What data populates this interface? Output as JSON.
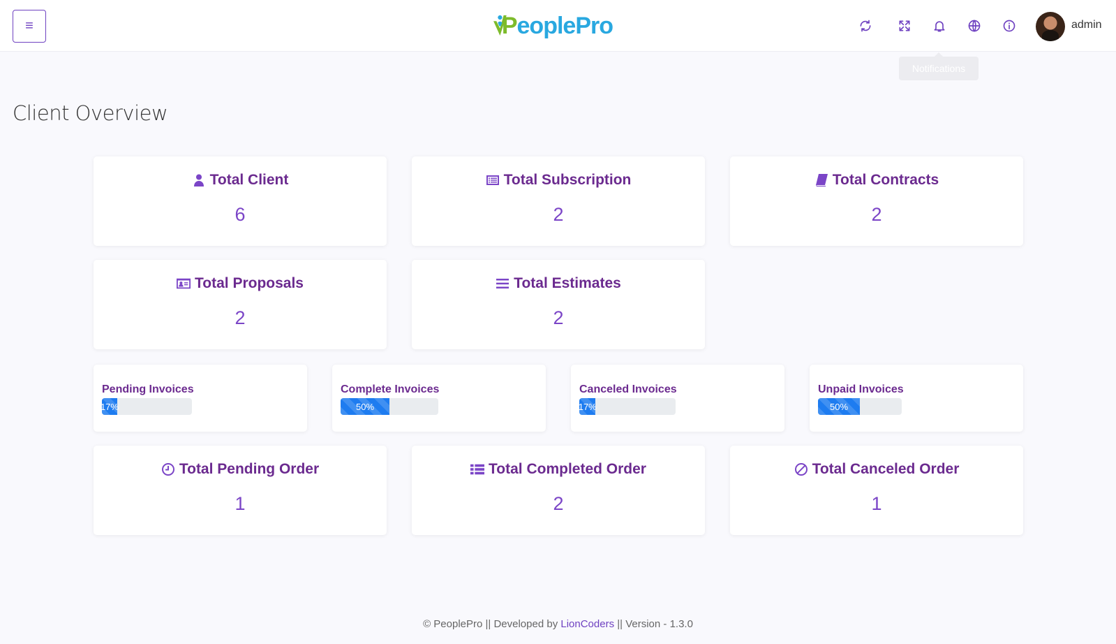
{
  "header": {
    "logo": {
      "part1": "P",
      "part2": "eoplePro"
    },
    "tooltip": "Notifications",
    "user_name": "admin"
  },
  "page": {
    "title": "Client Overview"
  },
  "cards": [
    {
      "title": "Total Client",
      "value": "6",
      "icon": "user-icon"
    },
    {
      "title": "Total Subscription",
      "value": "2",
      "icon": "list-alt-icon"
    },
    {
      "title": "Total Contracts",
      "value": "2",
      "icon": "book-icon"
    },
    {
      "title": "Total Proposals",
      "value": "2",
      "icon": "id-card-icon"
    },
    {
      "title": "Total Estimates",
      "value": "2",
      "icon": "bars-icon"
    }
  ],
  "invoices": [
    {
      "label": "Pending Invoices",
      "percent_text": "17%",
      "percent": 17
    },
    {
      "label": "Complete Invoices",
      "percent_text": "50%",
      "percent": 50
    },
    {
      "label": "Canceled Invoices",
      "percent_text": "17%",
      "percent": 17
    },
    {
      "label": "Unpaid Invoices",
      "percent_text": "50%",
      "percent": 50
    }
  ],
  "orders": [
    {
      "title": "Total Pending Order",
      "value": "1",
      "icon": "clock-icon"
    },
    {
      "title": "Total Completed Order",
      "value": "2",
      "icon": "th-list-icon"
    },
    {
      "title": "Total Canceled Order",
      "value": "1",
      "icon": "ban-icon"
    }
  ],
  "footer": {
    "prefix": "© PeoplePro || Developed by",
    "link": "LionCoders",
    "suffix": "|| Version - 1.3.0"
  },
  "colors": {
    "accent": "#6f42c1",
    "card_title": "#6b2a8f",
    "progress": "#1e7cf0"
  }
}
